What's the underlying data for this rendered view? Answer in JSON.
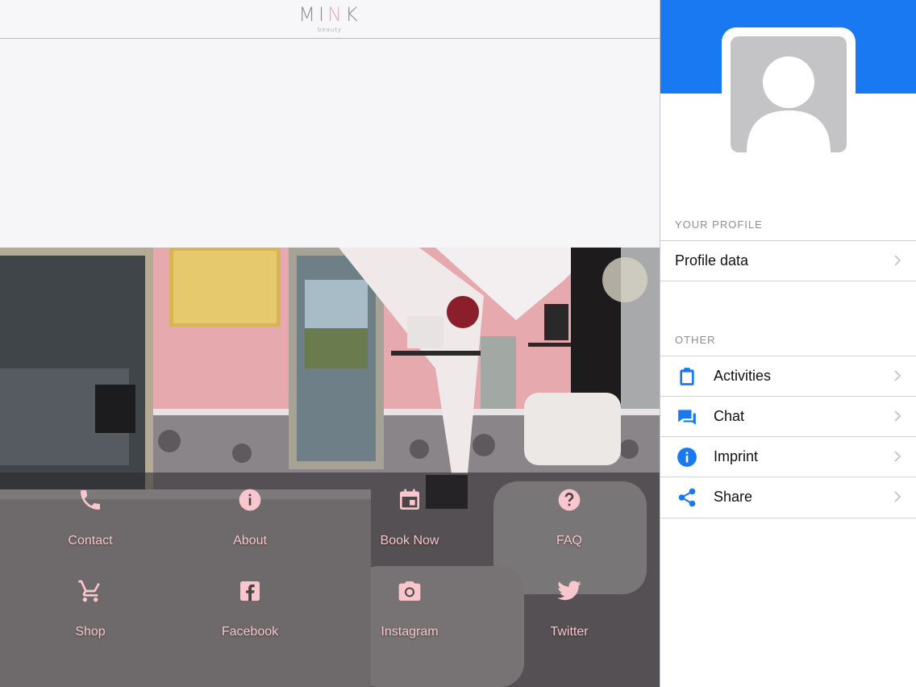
{
  "header": {
    "logo_word": "MINK",
    "logo_sub": "beauty"
  },
  "colors": {
    "accent_blue": "#1879f2",
    "tile_pink": "#f8c6cc",
    "logo_pink": "#f2a9b3"
  },
  "tiles": [
    {
      "label": "Contact",
      "icon": "phone-icon"
    },
    {
      "label": "About",
      "icon": "info-icon"
    },
    {
      "label": "Book Now",
      "icon": "calendar-icon"
    },
    {
      "label": "FAQ",
      "icon": "question-icon"
    },
    {
      "label": "Shop",
      "icon": "cart-icon"
    },
    {
      "label": "Facebook",
      "icon": "facebook-icon"
    },
    {
      "label": "Instagram",
      "icon": "camera-icon"
    },
    {
      "label": "Twitter",
      "icon": "twitter-icon"
    }
  ],
  "panel": {
    "profile_section": "YOUR PROFILE",
    "profile_row": "Profile data",
    "other_section": "OTHER",
    "other_rows": [
      {
        "label": "Activities",
        "icon": "clipboard-icon"
      },
      {
        "label": "Chat",
        "icon": "chat-icon"
      },
      {
        "label": "Imprint",
        "icon": "info-icon"
      },
      {
        "label": "Share",
        "icon": "share-icon"
      }
    ]
  }
}
